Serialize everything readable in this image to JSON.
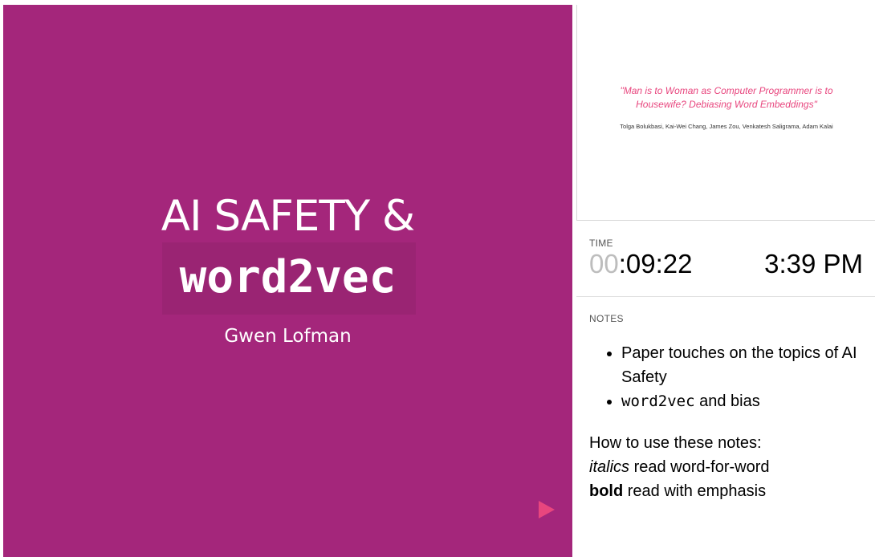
{
  "slide": {
    "title": "AI SAFETY &",
    "code_title": "word2vec",
    "author": "Gwen Lofman",
    "background_color": "#a4267b",
    "next_icon": "play-triangle-icon"
  },
  "preview": {
    "title_line1": "\"Man is to Woman as Computer Programmer is to",
    "title_line2": "Housewife? Debiasing Word Embeddings\"",
    "authors": "Tolga Bolukbasi, Kai-Wei Chang, James Zou, Venkatesh Saligrama, Adam Kalai"
  },
  "time": {
    "label": "TIME",
    "elapsed_dim": "00",
    "elapsed_rest": ":09:22",
    "clock": "3:39 PM"
  },
  "notes": {
    "label": "NOTES",
    "bullet1": "Paper touches on the topics of AI Safety",
    "bullet2_code": "word2vec",
    "bullet2_rest": " and bias",
    "howto_heading": "How to use these notes:",
    "italics_word": "italics",
    "italics_rest": " read word-for-word",
    "bold_word": "bold",
    "bold_rest": " read with emphasis"
  }
}
